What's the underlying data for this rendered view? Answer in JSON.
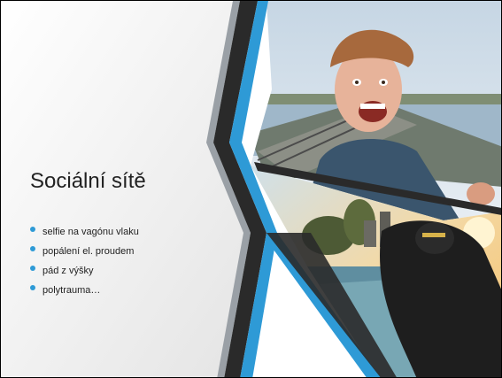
{
  "slide": {
    "title": "Sociální sítě",
    "bullets": [
      "selfie na vagónu vlaku",
      "popálení el. proudem",
      "pád z výšky",
      "polytrauma…"
    ]
  },
  "images": [
    {
      "name": "selfie-photo",
      "description_icon": "photo"
    },
    {
      "name": "train-roof-photo",
      "description_icon": "photo"
    }
  ],
  "colors": {
    "accent_blue": "#2e9ad6",
    "dark_stripe": "#2a2a2a",
    "gray_stripe": "#9aa0a6",
    "panel_gradient_start": "#ffffff",
    "panel_gradient_end": "#e6e6e6"
  }
}
